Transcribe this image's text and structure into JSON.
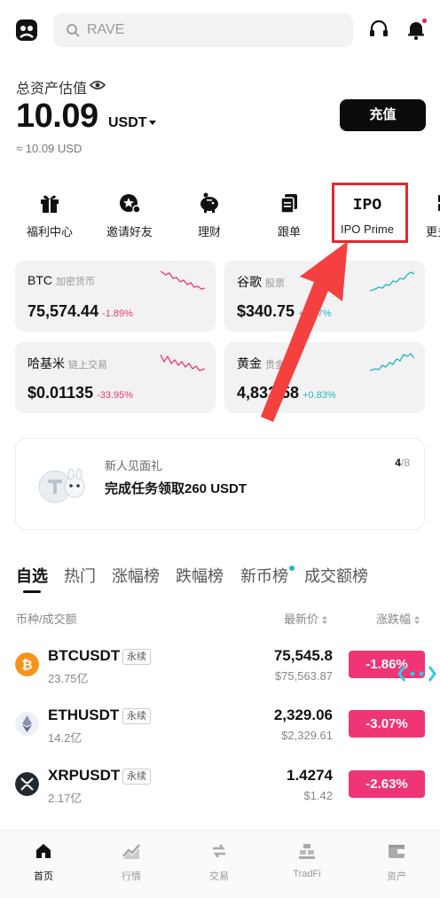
{
  "search": {
    "placeholder": "RAVE"
  },
  "assets": {
    "label": "总资产估值",
    "value": "10.09",
    "unit": "USDT",
    "approx": "≈ 10.09 USD",
    "deposit_label": "充值"
  },
  "quick_actions": [
    {
      "label": "福利中心",
      "icon": "gift-icon"
    },
    {
      "label": "邀请好友",
      "icon": "invite-icon"
    },
    {
      "label": "理财",
      "icon": "piggy-bank-icon"
    },
    {
      "label": "跟单",
      "icon": "copy-trade-icon"
    },
    {
      "label": "IPO Prime",
      "icon": "ipo-icon",
      "icon_text": "IPO"
    },
    {
      "label": "更多",
      "icon": "more-icon"
    }
  ],
  "market_cards": [
    {
      "name": "BTC",
      "sub": "加密货币",
      "price": "75,574.44",
      "change": "-1.89%",
      "trend": "down"
    },
    {
      "name": "谷歌",
      "sub": "股票",
      "price": "$340.75",
      "change": "+1.17%",
      "trend": "up"
    },
    {
      "name": "哈基米",
      "sub": "链上交易",
      "price": "$0.01135",
      "change": "-33.95%",
      "trend": "down"
    },
    {
      "name": "黄金",
      "sub": "贵金属",
      "price": "4,832.58",
      "change": "+0.83%",
      "trend": "up"
    }
  ],
  "promo": {
    "small": "新人见面礼",
    "big": "完成任务领取260 USDT",
    "page_current": "4",
    "page_total": "/8"
  },
  "tabs": [
    "自选",
    "热门",
    "涨幅榜",
    "跌幅榜",
    "新币榜",
    "成交额榜"
  ],
  "table_header": {
    "pair": "币种/成交额",
    "price": "最新价",
    "change": "涨跌幅"
  },
  "rows": [
    {
      "symbol": "BTCUSDT",
      "tag": "永续",
      "volume": "23.75亿",
      "price": "75,545.8",
      "fiat": "$75,563.87",
      "change": "-1.86%"
    },
    {
      "symbol": "ETHUSDT",
      "tag": "永续",
      "volume": "14.2亿",
      "price": "2,329.06",
      "fiat": "$2,329.61",
      "change": "-3.07%"
    },
    {
      "symbol": "XRPUSDT",
      "tag": "永续",
      "volume": "2.17亿",
      "price": "1.4274",
      "fiat": "$1.42",
      "change": "-2.63%"
    }
  ],
  "bottom_nav": [
    {
      "label": "首页",
      "icon": "home-icon",
      "active": true
    },
    {
      "label": "行情",
      "icon": "market-icon"
    },
    {
      "label": "交易",
      "icon": "trade-icon"
    },
    {
      "label": "TradFi",
      "icon": "tradfi-icon"
    },
    {
      "label": "资产",
      "icon": "wallet-icon"
    }
  ],
  "colors": {
    "down": "#ef3575",
    "up": "#22b6c0",
    "highlight": "#e4282d"
  }
}
